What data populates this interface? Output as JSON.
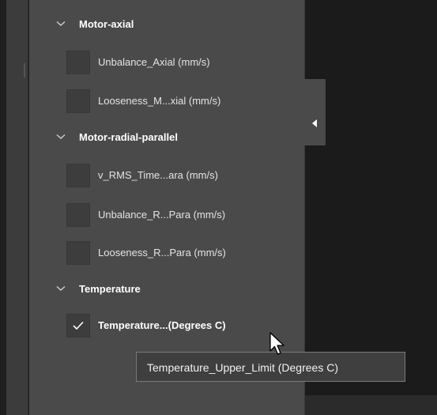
{
  "groups": [
    {
      "label": "Motor-axial",
      "items": [
        {
          "label": "Unbalance_Axial (mm/s)",
          "checked": false
        },
        {
          "label": "Looseness_M...xial (mm/s)",
          "checked": false
        }
      ]
    },
    {
      "label": "Motor-radial-parallel",
      "items": [
        {
          "label": "v_RMS_Time...ara (mm/s)",
          "checked": false
        },
        {
          "label": "Unbalance_R...Para (mm/s)",
          "checked": false
        },
        {
          "label": "Looseness_R...Para (mm/s)",
          "checked": false
        }
      ]
    },
    {
      "label": "Temperature",
      "items": [
        {
          "label": "Temperature...(Degrees C)",
          "checked": true
        }
      ]
    }
  ],
  "tooltip": {
    "text": "Temperature_Upper_Limit (Degrees C)"
  },
  "icons": {
    "group_chevron": "chevron-down-icon",
    "collapse_tab": "triangle-left-icon",
    "checkmark": "checkmark-icon",
    "cursor": "mouse-pointer-icon"
  },
  "colors": {
    "panel": "#4a4a4a",
    "checkbox": "#3d3d3d",
    "tooltip_border": "#7a7a7a"
  }
}
